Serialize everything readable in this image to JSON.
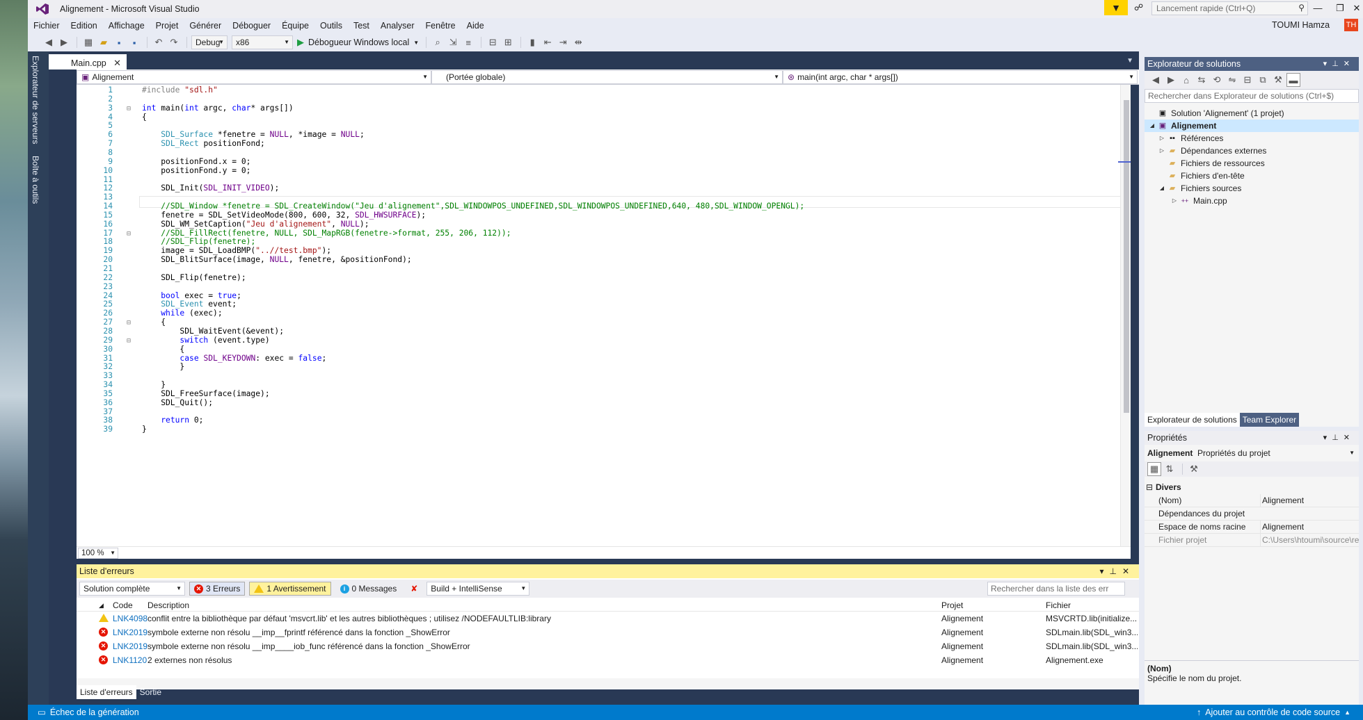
{
  "window": {
    "title": "Alignement - Microsoft Visual Studio",
    "quick_launch_placeholder": "Lancement rapide (Ctrl+Q)",
    "user": "TOUMI Hamza",
    "avatar_initials": "TH",
    "minimize": "—",
    "maximize": "❐",
    "close": "✕"
  },
  "menu": [
    "Fichier",
    "Edition",
    "Affichage",
    "Projet",
    "Générer",
    "Déboguer",
    "Équipe",
    "Outils",
    "Test",
    "Analyser",
    "Fenêtre",
    "Aide"
  ],
  "toolbar": {
    "config": "Debug",
    "platform": "x86",
    "start_label": "Débogueur Windows local"
  },
  "left_strip": {
    "tab1": "Explorateur de serveurs",
    "tab2": "Boîte à outils"
  },
  "editor": {
    "tab_label": "Main.cpp",
    "nav_project": "Alignement",
    "nav_scope": "(Portée globale)",
    "nav_member": "main(int argc, char * args[])",
    "zoom": "100 %"
  },
  "code_lines": [
    "#include \"sdl.h\"",
    "",
    "int main(int argc, char* args[])",
    "{",
    "",
    "    SDL_Surface *fenetre = NULL, *image = NULL;",
    "    SDL_Rect positionFond;",
    "",
    "    positionFond.x = 0;",
    "    positionFond.y = 0;",
    "",
    "    SDL_Init(SDL_INIT_VIDEO);",
    "",
    "    //SDL_Window *fenetre = SDL_CreateWindow(\"Jeu d'alignement\",SDL_WINDOWPOS_UNDEFINED,SDL_WINDOWPOS_UNDEFINED,640, 480,SDL_WINDOW_OPENGL);",
    "    fenetre = SDL_SetVideoMode(800, 600, 32, SDL_HWSURFACE);",
    "    SDL_WM_SetCaption(\"Jeu d'alignement\", NULL);",
    "    //SDL_FillRect(fenetre, NULL, SDL_MapRGB(fenetre->format, 255, 206, 112));",
    "    //SDL_Flip(fenetre);",
    "    image = SDL_LoadBMP(\"..//test.bmp\");",
    "    SDL_BlitSurface(image, NULL, fenetre, &positionFond);",
    "",
    "    SDL_Flip(fenetre);",
    "",
    "    bool exec = true;",
    "    SDL_Event event;",
    "    while (exec);",
    "    {",
    "        SDL_WaitEvent(&event);",
    "        switch (event.type)",
    "        {",
    "        case SDL_KEYDOWN: exec = false;",
    "        }",
    "",
    "    }",
    "    SDL_FreeSurface(image);",
    "    SDL_Quit();",
    "",
    "    return 0;",
    "}"
  ],
  "errors_panel": {
    "title": "Liste d'erreurs",
    "scope": "Solution complète",
    "errors_label": "3 Erreurs",
    "warnings_label": "1 Avertissement",
    "messages_label": "0 Messages",
    "build_filter": "Build + IntelliSense",
    "search_placeholder": "Rechercher dans la liste des err",
    "columns": {
      "code": "Code",
      "description": "Description",
      "project": "Projet",
      "file": "Fichier"
    },
    "rows": [
      {
        "severity": "warning",
        "code": "LNK4098",
        "description": "conflit entre la bibliothèque par défaut 'msvcrt.lib' et les autres bibliothèques ; utilisez /NODEFAULTLIB:library",
        "project": "Alignement",
        "file": "MSVCRTD.lib(initialize..."
      },
      {
        "severity": "error",
        "code": "LNK2019",
        "description": "symbole externe non résolu __imp__fprintf référencé dans la fonction _ShowError",
        "project": "Alignement",
        "file": "SDLmain.lib(SDL_win3..."
      },
      {
        "severity": "error",
        "code": "LNK2019",
        "description": "symbole externe non résolu __imp____iob_func référencé dans la fonction _ShowError",
        "project": "Alignement",
        "file": "SDLmain.lib(SDL_win3..."
      },
      {
        "severity": "error",
        "code": "LNK1120",
        "description": "2 externes non résolus",
        "project": "Alignement",
        "file": "Alignement.exe"
      }
    ],
    "bottom_tabs": [
      "Liste d'erreurs",
      "Sortie"
    ]
  },
  "solution_explorer": {
    "title": "Explorateur de solutions",
    "search_placeholder": "Rechercher dans Explorateur de solutions (Ctrl+$)",
    "solution": "Solution 'Alignement' (1 projet)",
    "project": "Alignement",
    "items": [
      "Références",
      "Dépendances externes",
      "Fichiers de ressources",
      "Fichiers d'en-tête",
      "Fichiers sources"
    ],
    "file": "Main.cpp",
    "tabs": [
      "Explorateur de solutions",
      "Team Explorer"
    ]
  },
  "properties": {
    "title": "Propriétés",
    "object_name": "Alignement",
    "object_type": "Propriétés du projet",
    "category": "Divers",
    "rows": [
      {
        "name": "(Nom)",
        "value": "Alignement"
      },
      {
        "name": "Dépendances du projet",
        "value": ""
      },
      {
        "name": "Espace de noms racine",
        "value": "Alignement"
      },
      {
        "name": "Fichier projet",
        "value": "C:\\Users\\htoumi\\source\\repos\\A"
      }
    ],
    "desc_title": "(Nom)",
    "desc_text": "Spécifie le nom du projet."
  },
  "status": {
    "left": "Échec de la génération",
    "right": "Ajouter au contrôle de code source"
  }
}
